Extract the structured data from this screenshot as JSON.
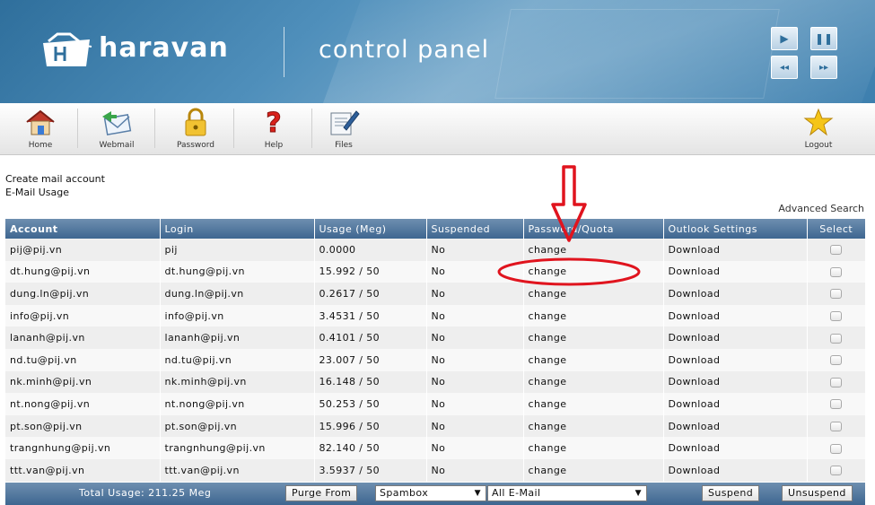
{
  "brand": {
    "logo_text": "haravan",
    "subtitle": "control panel"
  },
  "media_controls": [
    {
      "name": "play-icon",
      "glyph": "▶"
    },
    {
      "name": "pause-icon",
      "glyph": "❚❚"
    },
    {
      "name": "rewind-icon",
      "glyph": "◂◂"
    },
    {
      "name": "fast-forward-icon",
      "glyph": "▸▸"
    }
  ],
  "toolbar": {
    "home_label": "Home",
    "webmail_label": "Webmail",
    "password_label": "Password",
    "help_label": "Help",
    "files_label": "Files",
    "logout_label": "Logout"
  },
  "links": {
    "create_account": "Create mail account",
    "email_usage": "E-Mail Usage",
    "advanced_search": "Advanced Search"
  },
  "table": {
    "columns": [
      "Account",
      "Login",
      "Usage (Meg)",
      "Suspended",
      "Password/Quota",
      "Outlook Settings",
      "Select"
    ],
    "rows": [
      {
        "account": "pij@pij.vn",
        "login": "pij",
        "usage": "0.0000",
        "suspended": "No",
        "password": "change",
        "outlook": "Download"
      },
      {
        "account": "dt.hung@pij.vn",
        "login": "dt.hung@pij.vn",
        "usage": "15.992 / 50",
        "suspended": "No",
        "password": "change",
        "outlook": "Download"
      },
      {
        "account": "dung.ln@pij.vn",
        "login": "dung.ln@pij.vn",
        "usage": "0.2617 / 50",
        "suspended": "No",
        "password": "change",
        "outlook": "Download"
      },
      {
        "account": "info@pij.vn",
        "login": "info@pij.vn",
        "usage": "3.4531 / 50",
        "suspended": "No",
        "password": "change",
        "outlook": "Download"
      },
      {
        "account": "lananh@pij.vn",
        "login": "lananh@pij.vn",
        "usage": "0.4101 / 50",
        "suspended": "No",
        "password": "change",
        "outlook": "Download"
      },
      {
        "account": "nd.tu@pij.vn",
        "login": "nd.tu@pij.vn",
        "usage": "23.007 / 50",
        "suspended": "No",
        "password": "change",
        "outlook": "Download"
      },
      {
        "account": "nk.minh@pij.vn",
        "login": "nk.minh@pij.vn",
        "usage": "16.148 / 50",
        "suspended": "No",
        "password": "change",
        "outlook": "Download"
      },
      {
        "account": "nt.nong@pij.vn",
        "login": "nt.nong@pij.vn",
        "usage": "50.253 / 50",
        "suspended": "No",
        "password": "change",
        "outlook": "Download"
      },
      {
        "account": "pt.son@pij.vn",
        "login": "pt.son@pij.vn",
        "usage": "15.996 / 50",
        "suspended": "No",
        "password": "change",
        "outlook": "Download"
      },
      {
        "account": "trangnhung@pij.vn",
        "login": "trangnhung@pij.vn",
        "usage": "82.140 / 50",
        "suspended": "No",
        "password": "change",
        "outlook": "Download"
      },
      {
        "account": "ttt.van@pij.vn",
        "login": "ttt.van@pij.vn",
        "usage": "3.5937 / 50",
        "suspended": "No",
        "password": "change",
        "outlook": "Download"
      }
    ]
  },
  "footer": {
    "total_usage": "Total Usage: 211.25 Meg",
    "purge_label": "Purge From",
    "purge_target": "Spambox",
    "email_filter": "All E-Mail",
    "suspend_label": "Suspend",
    "unsuspend_label": "Unsuspend"
  },
  "colors": {
    "banner": "#3d7fae",
    "header_bar": "#3e6690",
    "annotation": "#e0141e"
  }
}
